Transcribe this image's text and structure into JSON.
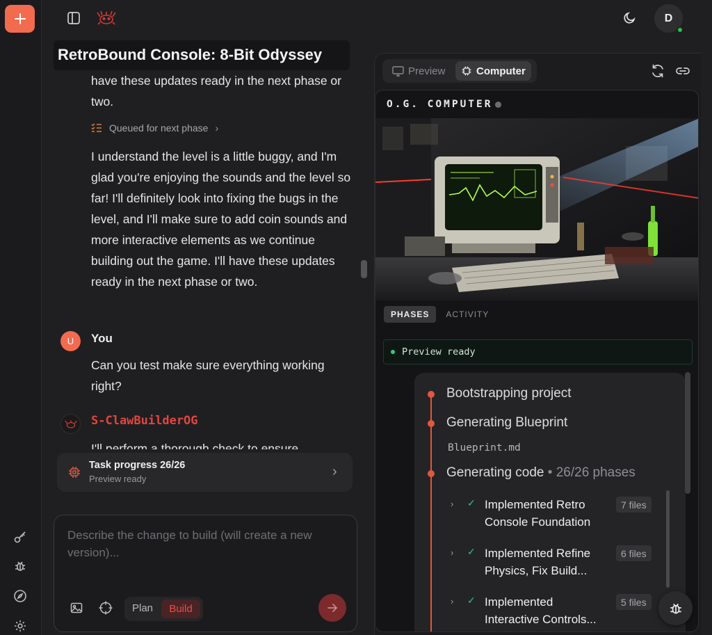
{
  "header": {
    "avatar_initial": "D"
  },
  "chat": {
    "title": "RetroBound Console: 8-Bit Odyssey",
    "prev_msg_tail": "have these updates ready in the next phase or two.",
    "queued_label": "Queued for next phase",
    "assistant_msg": "I understand the level is a little buggy, and I'm glad you're enjoying the sounds and the level so far! I'll definitely look into fixing the bugs in the level, and I'll make sure to add coin sounds and more interactive elements as we continue building out the game. I'll have these updates ready in the next phase or two.",
    "user_avatar": "U",
    "user_name": "You",
    "user_msg": "Can you test make sure everything working right?",
    "bot_name": "S-ClawBuilderOG",
    "bot_msg": "I'll perform a thorough check to ensure"
  },
  "task": {
    "title": "Task progress 26/26",
    "subtitle": "Preview ready"
  },
  "composer": {
    "placeholder": "Describe the change to build (will create a new version)...",
    "mode_plan": "Plan",
    "mode_build": "Build"
  },
  "panel": {
    "tab_preview": "Preview",
    "tab_computer": "Computer",
    "computer_title": "O.G. COMPUTER",
    "subtab_phases": "PHASES",
    "subtab_activity": "ACTIVITY",
    "preview_status": "Preview ready",
    "phases": [
      {
        "label": "Bootstrapping project"
      },
      {
        "label": "Generating Blueprint",
        "sub": "Blueprint.md"
      },
      {
        "label": "Generating code",
        "count": "26/26 phases"
      }
    ],
    "subphases": [
      {
        "label": "Implemented Retro Console Foundation",
        "files": "7 files"
      },
      {
        "label": "Implemented Refine Physics, Fix Build...",
        "files": "6 files"
      },
      {
        "label": "Implemented Interactive Controls...",
        "files": "5 files"
      }
    ]
  },
  "colors": {
    "accent": "#f26b4f",
    "brand_red": "#e2453f",
    "success": "#2fc27a"
  }
}
